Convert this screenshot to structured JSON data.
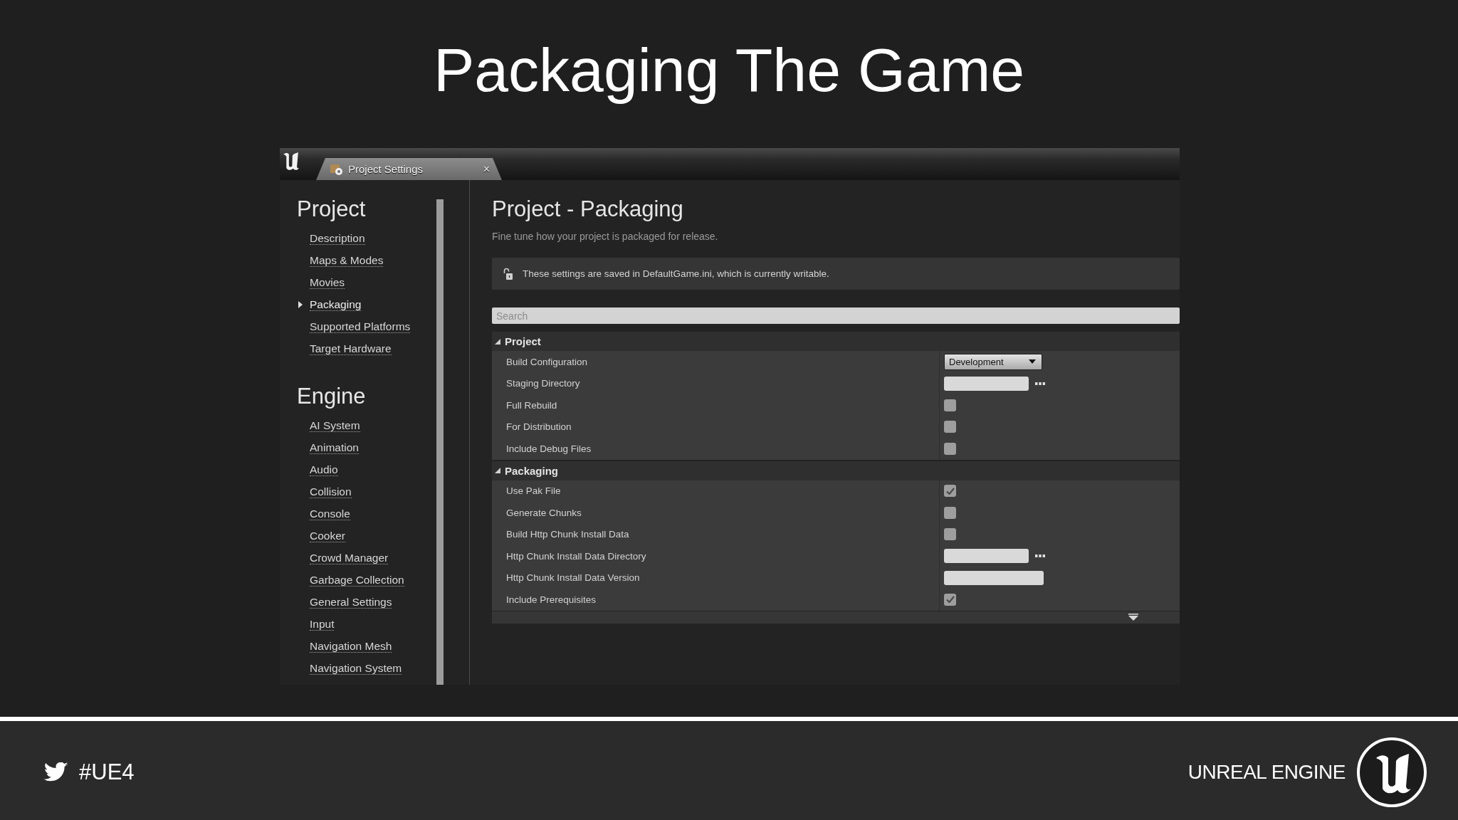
{
  "slide_title": "Packaging The Game",
  "window": {
    "tab": {
      "label": "Project Settings",
      "close": "×"
    }
  },
  "sidebar": {
    "sections": [
      {
        "heading": "Project",
        "items": [
          {
            "label": "Description",
            "selected": false
          },
          {
            "label": "Maps & Modes",
            "selected": false
          },
          {
            "label": "Movies",
            "selected": false
          },
          {
            "label": "Packaging",
            "selected": true
          },
          {
            "label": "Supported Platforms",
            "selected": false
          },
          {
            "label": "Target Hardware",
            "selected": false
          }
        ]
      },
      {
        "heading": "Engine",
        "items": [
          {
            "label": "AI System",
            "selected": false
          },
          {
            "label": "Animation",
            "selected": false
          },
          {
            "label": "Audio",
            "selected": false
          },
          {
            "label": "Collision",
            "selected": false
          },
          {
            "label": "Console",
            "selected": false
          },
          {
            "label": "Cooker",
            "selected": false
          },
          {
            "label": "Crowd Manager",
            "selected": false
          },
          {
            "label": "Garbage Collection",
            "selected": false
          },
          {
            "label": "General Settings",
            "selected": false
          },
          {
            "label": "Input",
            "selected": false
          },
          {
            "label": "Navigation Mesh",
            "selected": false
          },
          {
            "label": "Navigation System",
            "selected": false
          }
        ]
      }
    ]
  },
  "main": {
    "title": "Project - Packaging",
    "subtitle": "Fine tune how your project is packaged for release.",
    "notice": "These settings are saved in DefaultGame.ini, which is currently writable.",
    "search": {
      "placeholder": "Search"
    },
    "categories": [
      {
        "name": "Project",
        "expanded": true,
        "rows": [
          {
            "label": "Build Configuration",
            "kind": "dropdown",
            "value": "Development"
          },
          {
            "label": "Staging Directory",
            "kind": "path"
          },
          {
            "label": "Full Rebuild",
            "kind": "checkbox",
            "checked": false
          },
          {
            "label": "For Distribution",
            "kind": "checkbox",
            "checked": false
          },
          {
            "label": "Include Debug Files",
            "kind": "checkbox",
            "checked": false
          }
        ]
      },
      {
        "name": "Packaging",
        "expanded": true,
        "rows": [
          {
            "label": "Use Pak File",
            "kind": "checkbox",
            "checked": true
          },
          {
            "label": "Generate Chunks",
            "kind": "checkbox",
            "checked": false
          },
          {
            "label": "Build Http Chunk Install Data",
            "kind": "checkbox",
            "checked": false
          },
          {
            "label": "Http Chunk Install Data Directory",
            "kind": "path"
          },
          {
            "label": "Http Chunk Install Data Version",
            "kind": "text"
          },
          {
            "label": "Include Prerequisites",
            "kind": "checkbox",
            "checked": true
          }
        ]
      }
    ]
  },
  "footer": {
    "hashtag": "#UE4",
    "brand": "UNREAL ENGINE"
  }
}
